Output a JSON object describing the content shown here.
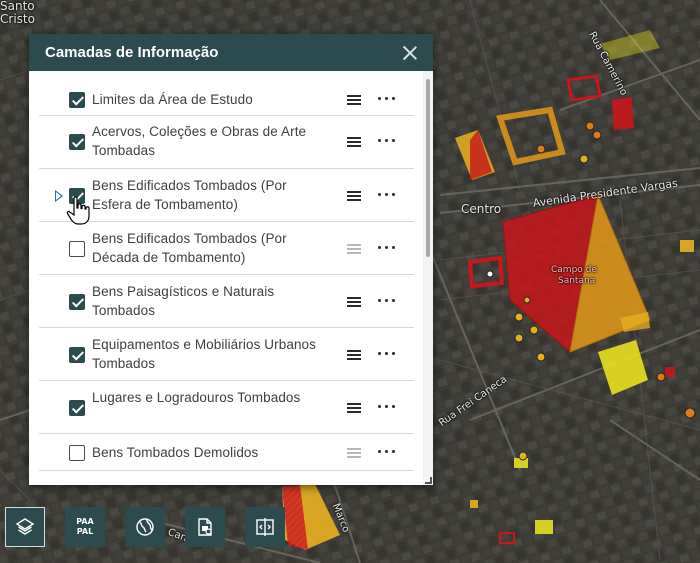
{
  "map": {
    "labels": {
      "santo_cristo_1": "Santo",
      "santo_cristo_2": "Cristo",
      "centro": "Centro",
      "rua_camerino": "Rua Camerino",
      "avenida_presidente_vargas": "Avenida Presidente Vargas",
      "campo_de_santana_1": "Campo de",
      "campo_de_santana_2": "Santana",
      "rua_frei_caneca": "Rua Frei Caneca",
      "marco": "Marco",
      "caneca": "Caneca"
    }
  },
  "panel": {
    "title": "Camadas de Informação",
    "layers": [
      {
        "label": "Limites da Área de Estudo",
        "checked": true
      },
      {
        "label": "Acervos, Coleções e Obras de Arte Tombadas",
        "checked": true
      },
      {
        "label": "Bens Edificados Tombados (Por Esfera de Tombamento)",
        "checked": true
      },
      {
        "label": "Bens Edificados Tombados (Por Década de Tombamento)",
        "checked": false
      },
      {
        "label": "Bens Paisagísticos e Naturais Tombados",
        "checked": true
      },
      {
        "label": "Equipamentos e Mobiliários Urbanos Tombados",
        "checked": true
      },
      {
        "label": "Lugares e Logradouros Tombados",
        "checked": true
      },
      {
        "label": "Bens Tombados Demolidos",
        "checked": false
      }
    ]
  },
  "toolbar": {
    "buttons": [
      {
        "name": "layers-button",
        "icon": "layers-icon"
      },
      {
        "name": "paa-pal-button",
        "icon": "paa-pal-icon",
        "text_top": "PAA",
        "text_bottom": "PAL"
      },
      {
        "name": "basemap-button",
        "icon": "globe-icon"
      },
      {
        "name": "document-button",
        "icon": "document-icon"
      },
      {
        "name": "compare-button",
        "icon": "compare-icon"
      }
    ]
  },
  "colors": {
    "panel_header": "#2b4b4f",
    "checkbox_checked": "#2b4b4f",
    "polygon_red": "#c8161a",
    "polygon_orange": "#d9931a",
    "polygon_yellow": "#e8e020",
    "point_orange": "#e07a1a"
  }
}
